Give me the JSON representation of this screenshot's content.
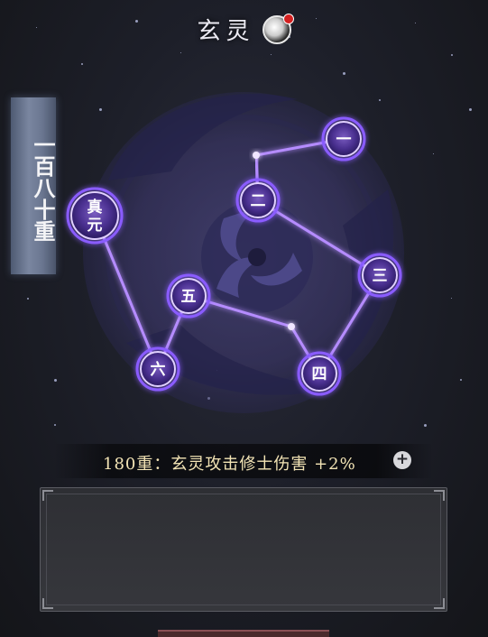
{
  "header": {
    "title": "玄灵",
    "orb_icon": "yin-yang-orb-icon",
    "badge_color": "#d32020"
  },
  "banner": {
    "text": "一百八十重"
  },
  "constellation": {
    "core_label": "真元",
    "nodes": [
      "一",
      "二",
      "三",
      "四",
      "五",
      "六"
    ],
    "line_color": "#b58cff",
    "glow_color": "#8a5cff"
  },
  "bonus": {
    "text": "180重：玄灵攻击修士伤害 +2%",
    "plus_label": "+"
  },
  "colors": {
    "emblem": "#3f3a6a",
    "text_gold": "#f3e4b5"
  }
}
